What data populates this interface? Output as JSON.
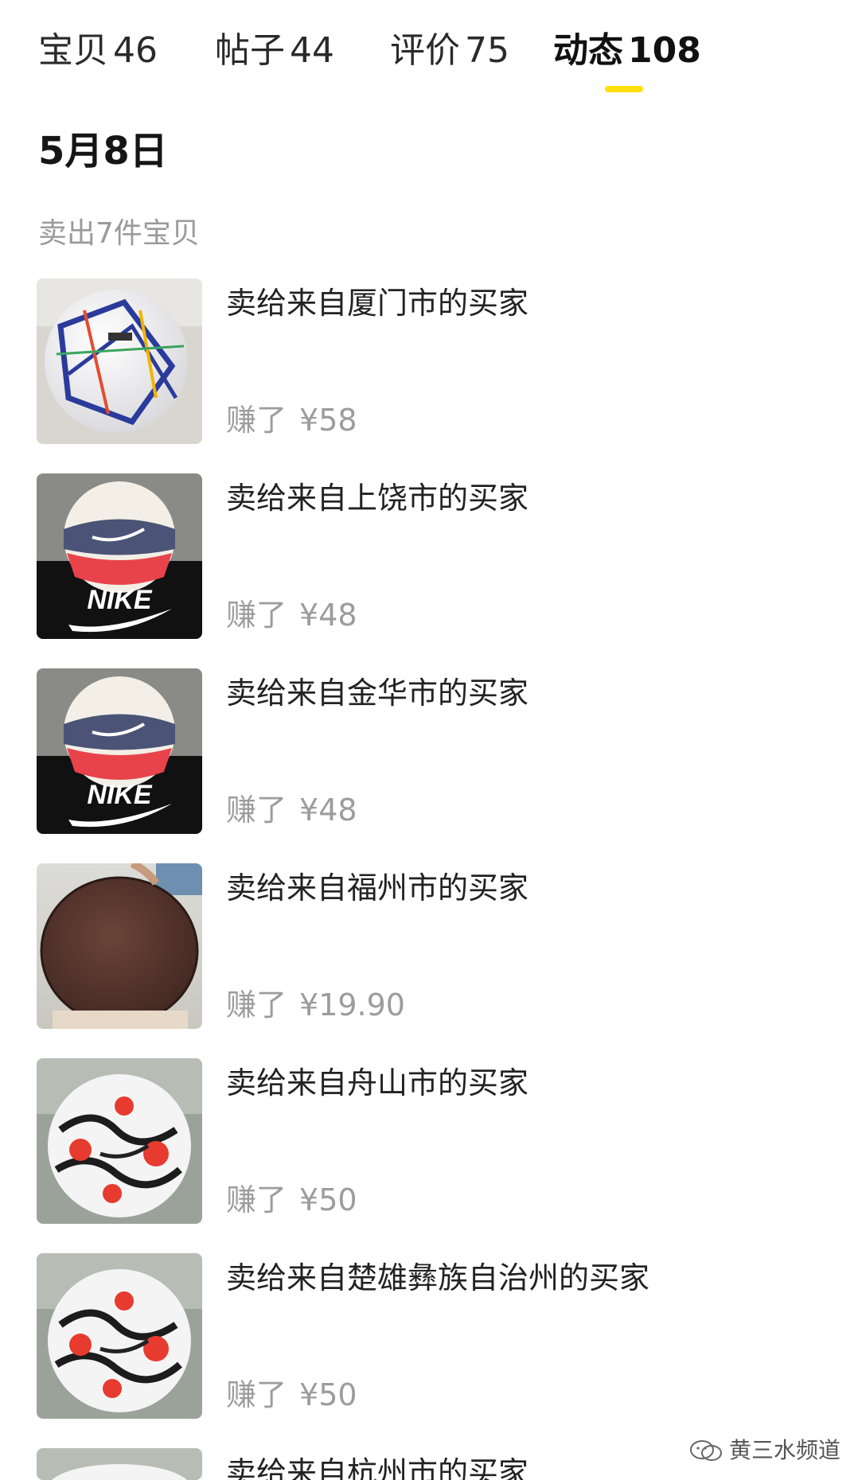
{
  "tabs": [
    {
      "label": "宝贝",
      "count": "46",
      "active": false
    },
    {
      "label": "帖子",
      "count": "44",
      "active": false
    },
    {
      "label": "评价",
      "count": "75",
      "active": false
    },
    {
      "label": "动态",
      "count": "108",
      "active": true
    }
  ],
  "accent_color": "#ffe00a",
  "date": "5月8日",
  "summary": "卖出7件宝贝",
  "earn_prefix": "赚了",
  "items": [
    {
      "title": "卖给来自厦门市的买家",
      "amount": "¥58",
      "thumb": "football-adidas"
    },
    {
      "title": "卖给来自上饶市的买家",
      "amount": "¥48",
      "thumb": "basketball-nike"
    },
    {
      "title": "卖给来自金华市的买家",
      "amount": "¥48",
      "thumb": "basketball-nike"
    },
    {
      "title": "卖给来自福州市的买家",
      "amount": "¥19.90",
      "thumb": "wooden-board"
    },
    {
      "title": "卖给来自舟山市的买家",
      "amount": "¥50",
      "thumb": "football-nike"
    },
    {
      "title": "卖给来自楚雄彝族自治州的买家",
      "amount": "¥50",
      "thumb": "football-nike"
    },
    {
      "title": "卖给来自杭州市的买家",
      "amount": "",
      "thumb": "football-nike"
    }
  ],
  "watermark": "黄三水频道"
}
